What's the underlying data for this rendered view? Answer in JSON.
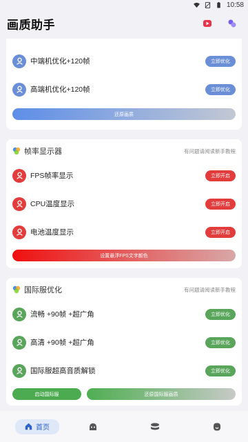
{
  "status_bar": {
    "time": "10:58",
    "icons": [
      "wifi-icon",
      "sim-off-icon",
      "battery-icon"
    ]
  },
  "app": {
    "title": "画质助手",
    "action_icons": [
      "play-icon",
      "theme-icon"
    ]
  },
  "colors": {
    "blue": "#6b8fd6",
    "red": "#e23c3c",
    "green": "#59a55c",
    "nav_active": "#2d62c8"
  },
  "graphics_card": {
    "rows": [
      {
        "label": "中端机优化+120帧",
        "button": "立即优化"
      },
      {
        "label": "高端机优化+120帧",
        "button": "立即优化"
      }
    ],
    "restore_button": "还原画质"
  },
  "fps_card": {
    "title": "帧率显示器",
    "hint": "有问题请阅读新手教程",
    "rows": [
      {
        "label": "FPS帧率显示",
        "button": "立即开启"
      },
      {
        "label": "CPU温度显示",
        "button": "立即开启"
      },
      {
        "label": "电池温度显示",
        "button": "立即开启"
      }
    ],
    "color_button": "设置悬浮FPS文字颜色"
  },
  "intl_card": {
    "title": "国际服优化",
    "hint": "有问题请阅读新手教程",
    "rows": [
      {
        "label": "流畅 +90帧 +超广角",
        "button": "立即优化"
      },
      {
        "label": "高清 +90帧 +超广角",
        "button": "立即优化"
      },
      {
        "label": "国际服超高音质解锁",
        "button": "立即优化"
      }
    ],
    "launch_button": "启动国际服",
    "restore_button": "还原国际服画质"
  },
  "bottom_nav": {
    "home_label": "首页",
    "icons": [
      "home-icon",
      "face-icon",
      "layers-icon",
      "profile-icon"
    ]
  }
}
